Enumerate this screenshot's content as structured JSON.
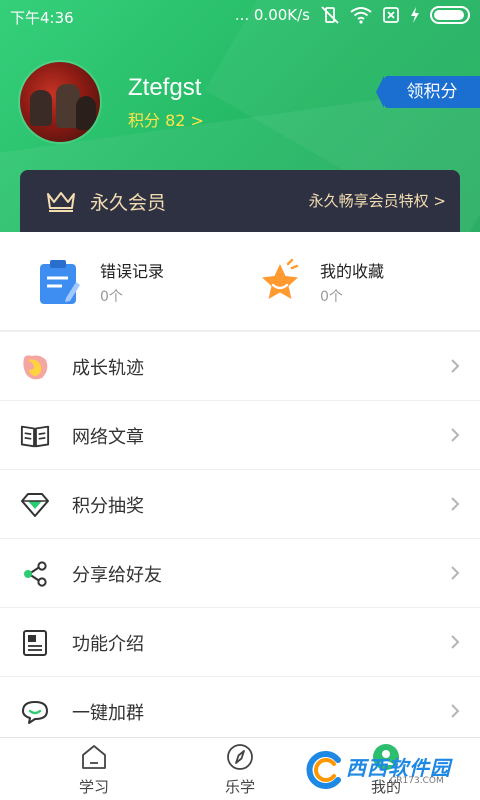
{
  "status_bar": {
    "time": "下午4:36",
    "network_speed": "... 0.00K/s"
  },
  "profile": {
    "username": "Ztefgst",
    "points": "积分 82 >",
    "get_points_button": "领积分"
  },
  "vip": {
    "title": "永久会员",
    "link": "永久畅享会员特权 >"
  },
  "quick_items": [
    {
      "title": "错误记录",
      "count": "0个",
      "icon": "notepad-icon",
      "color": "#3d8ef0"
    },
    {
      "title": "我的收藏",
      "count": "0个",
      "icon": "star-icon",
      "color": "#ff9a2e"
    }
  ],
  "menu": [
    {
      "label": "成长轨迹",
      "icon": "growth-icon"
    },
    {
      "label": "网络文章",
      "icon": "book-icon"
    },
    {
      "label": "积分抽奖",
      "icon": "gem-icon"
    },
    {
      "label": "分享给好友",
      "icon": "share-icon"
    },
    {
      "label": "功能介绍",
      "icon": "document-icon"
    },
    {
      "label": "一键加群",
      "icon": "chat-icon"
    }
  ],
  "bottom_nav": [
    {
      "label": "学习",
      "icon": "home-icon"
    },
    {
      "label": "乐学",
      "icon": "compass-icon"
    },
    {
      "label": "我的",
      "icon": "profile-icon",
      "active": true
    }
  ],
  "watermark": {
    "text": "西西软件园",
    "url": "CR173.COM"
  },
  "colors": {
    "brand_green": "#24b864",
    "vip_bg": "#2d3142",
    "vip_gold": "#f3dcb0",
    "points_yellow": "#ffe34a",
    "badge_blue": "#1b6fd1"
  }
}
